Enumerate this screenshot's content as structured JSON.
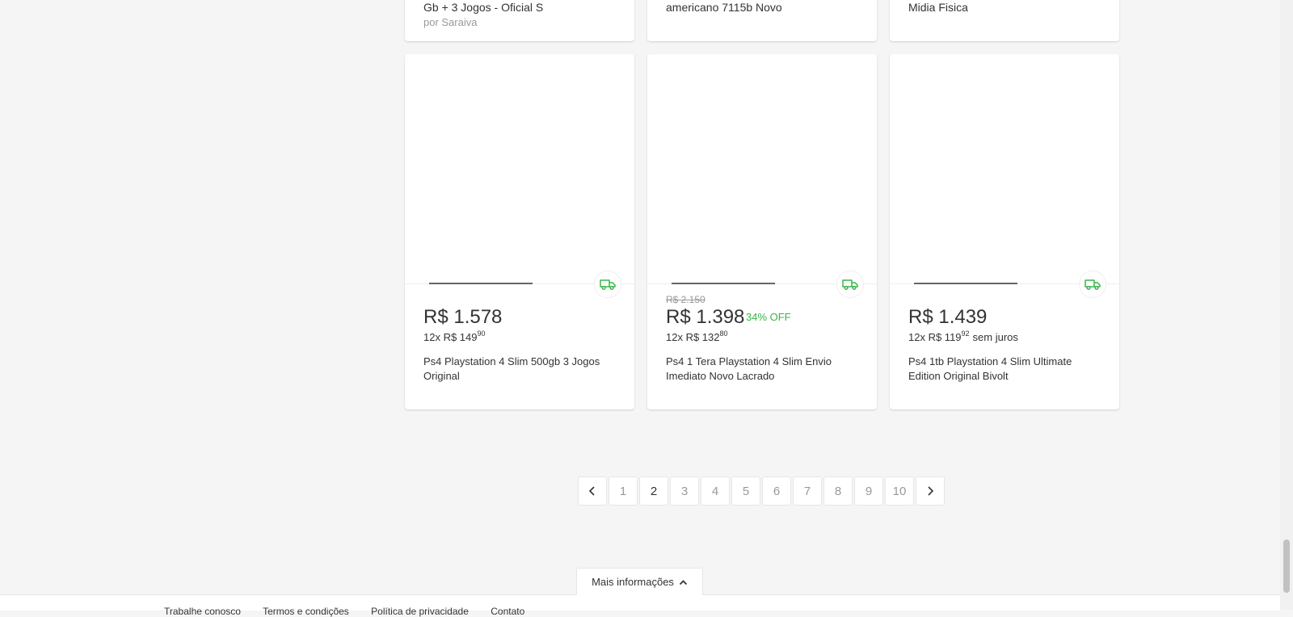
{
  "top_cards": [
    {
      "title": "Gb + 3 Jogos - Oficial S",
      "seller": "por Saraiva"
    },
    {
      "title": "americano 7115b Novo",
      "seller": ""
    },
    {
      "title": "Midia Fisica",
      "seller": ""
    }
  ],
  "products": [
    {
      "original_price": "",
      "price": "R$ 1.578",
      "discount": "",
      "installments_prefix": "12x R$ 149",
      "installments_cents": "90",
      "installments_suffix": "",
      "name": "Ps4 Playstation 4 Slim 500gb 3 Jogos Original"
    },
    {
      "original_price": "R$ 2.150",
      "price": "R$ 1.398",
      "discount": "34% OFF",
      "installments_prefix": "12x R$ 132",
      "installments_cents": "80",
      "installments_suffix": "",
      "name": "Ps4 1 Tera Playstation 4 Slim Envio Imediato Novo Lacrado"
    },
    {
      "original_price": "",
      "price": "R$ 1.439",
      "discount": "",
      "installments_prefix": "12x R$ 119",
      "installments_cents": "92",
      "installments_suffix": "sem juros",
      "name": "Ps4 1tb Playstation 4 Slim Ultimate Edition Original Bivolt"
    }
  ],
  "pagination": {
    "prev_icon": "chevron-left-icon",
    "next_icon": "chevron-right-icon",
    "pages": [
      "1",
      "2",
      "3",
      "4",
      "5",
      "6",
      "7",
      "8",
      "9",
      "10"
    ],
    "current": "2"
  },
  "more_info": {
    "label": "Mais informações",
    "icon": "chevron-up-icon"
  },
  "footer": {
    "links": [
      "Trabalhe conosco",
      "Termos e condições",
      "Política de privacidade",
      "Contato"
    ]
  },
  "colors": {
    "shipping_green": "#39b54a",
    "background": "#f5f5f5"
  }
}
